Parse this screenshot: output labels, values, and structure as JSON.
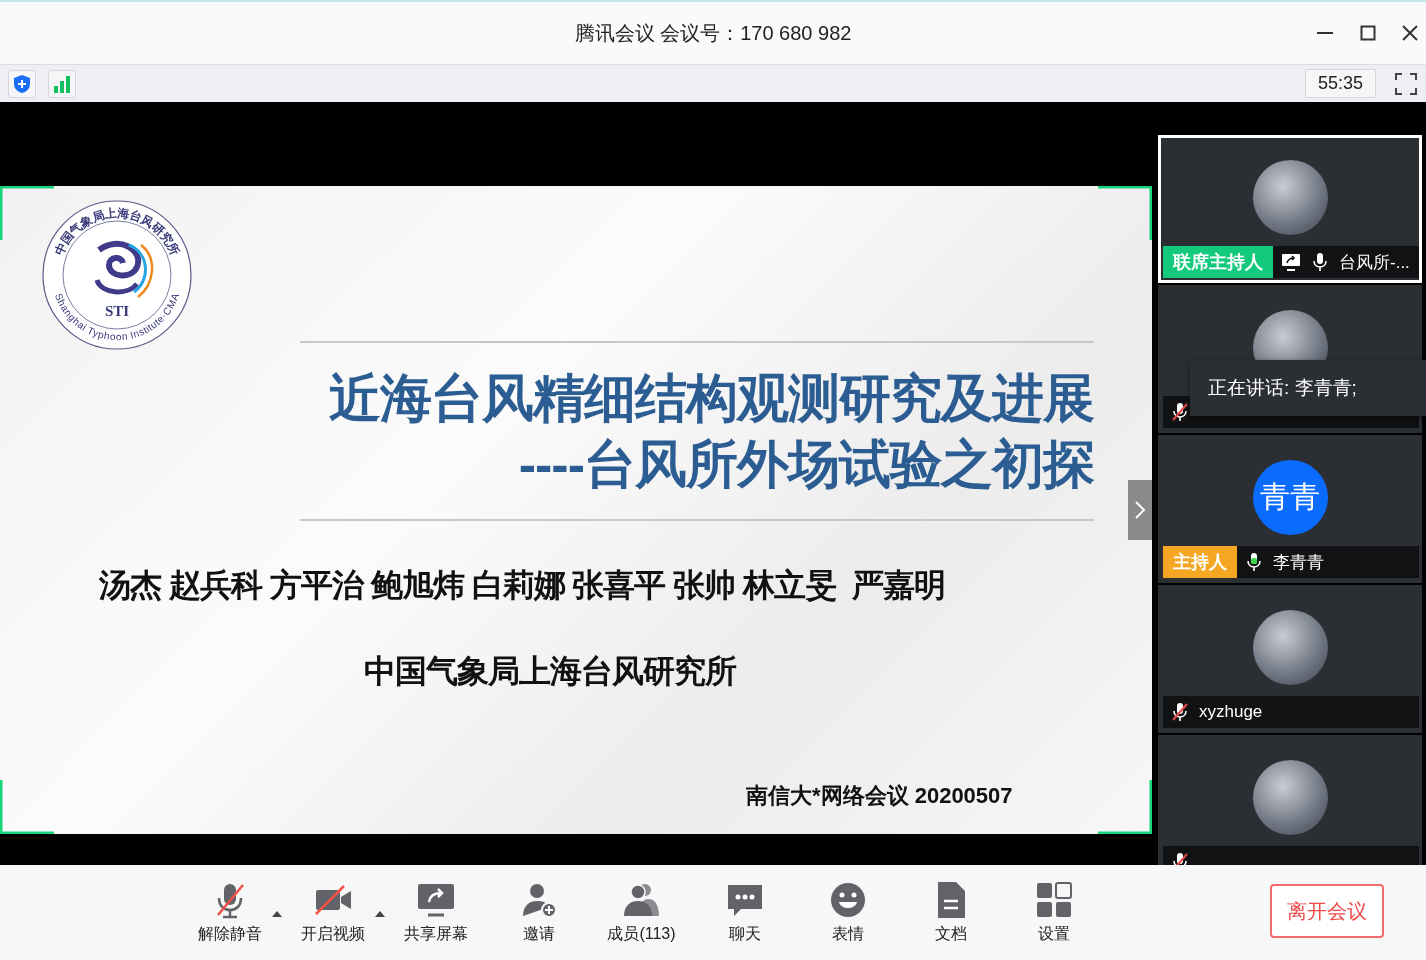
{
  "window": {
    "title": "腾讯会议 会议号：170 680 982"
  },
  "status": {
    "timer": "55:35"
  },
  "slide": {
    "title_lines": [
      "近海台风精细结构观测研究及进展",
      "----台风所外场试验之初探"
    ],
    "logo": {
      "ring_top": "中国气象局上海台风研究所",
      "ring_bottom": "Shanghai Typhoon Institute·CMA",
      "abbr": "STI"
    },
    "authors": "汤杰 赵兵科 方平治 鲍旭炜 白莉娜 张喜平 张帅 林立旻  严嘉明",
    "organization": "中国气象局上海台风研究所",
    "footer": "南信大*网络会议 20200507"
  },
  "participants": [
    {
      "role": {
        "label": "联席主持人",
        "color": "#12c97c"
      },
      "sharing": true,
      "muted": false,
      "speaking": false,
      "name": "台风所-...",
      "selected": true
    },
    {
      "sharing": false,
      "muted": true,
      "selected": false
    },
    {
      "initials": "青青",
      "role": {
        "label": "主持人",
        "color": "#f5a623"
      },
      "sharing": false,
      "muted": false,
      "speaking": true,
      "name": "李青青",
      "selected": false
    },
    {
      "sharing": false,
      "muted": true,
      "name": "xyzhuge",
      "selected": false
    },
    {
      "sharing": false,
      "muted": true,
      "selected": false
    }
  ],
  "speaking_tooltip": "正在讲话: 李青青;",
  "toolbar": [
    {
      "kind": "mic-off",
      "label": "解除静音",
      "menu": true
    },
    {
      "kind": "video-off",
      "label": "开启视频",
      "menu": true
    },
    {
      "kind": "share",
      "label": "共享屏幕",
      "menu": false
    },
    {
      "kind": "invite",
      "label": "邀请",
      "menu": false
    },
    {
      "kind": "members",
      "label": "成员(113)",
      "menu": false
    },
    {
      "kind": "chat",
      "label": "聊天",
      "menu": false
    },
    {
      "kind": "emoji",
      "label": "表情",
      "menu": false
    },
    {
      "kind": "doc",
      "label": "文档",
      "menu": false
    },
    {
      "kind": "settings",
      "label": "设置",
      "menu": false
    }
  ],
  "leave_button": "离开会议"
}
